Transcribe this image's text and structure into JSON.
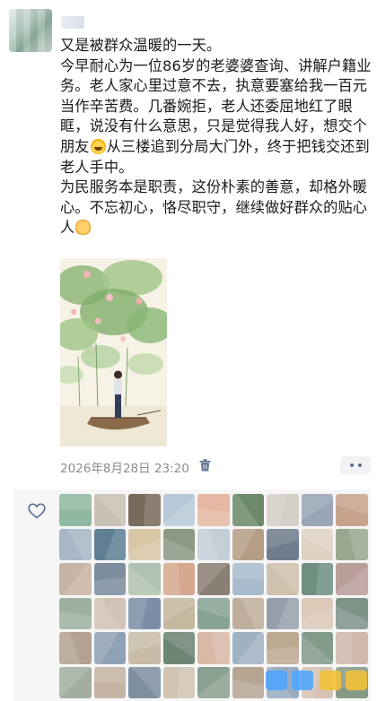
{
  "post": {
    "paragraphs": [
      "又是被群众温暖的一天。",
      "今早耐心为一位86岁的老婆婆查询、讲解户籍业务。老人家心里过意不去，执意要塞给我一百元当作辛苦费。几番婉拒，老人还委屈地红了眼眶，说没有什么意思，只是觉得我人好，想交个朋友",
      "从三楼追到分局大门外，终于把钱交还到老人手中。",
      "为民服务本是职责，这份朴素的善意，却格外暖心。不忘初心，恪尽职守，继续做好群众的贴心人"
    ],
    "timestamp": "2026年8月28日 23:20"
  },
  "icons": {
    "delete": "trash-icon",
    "more": "more-dots-icon",
    "like": "heart-outline-icon",
    "emoji1": "laughing-tears-emoji",
    "emoji2": "raised-fist-emoji"
  },
  "colors": {
    "timestamp": "#8c8c8c",
    "link_blue": "#5a6d8f",
    "likes_bg": "#f6f6f6"
  },
  "likes": {
    "avatars": [
      "#8fb8a0",
      "#c9c2b4",
      "#7a6a5a",
      "#b7c9d8",
      "#e6b7a3",
      "#6c8a6a",
      "#d4d0c8",
      "#9aa6b8",
      "#c7a38c",
      "#a7b7c7",
      "#5f7f95",
      "#d9c6a5",
      "#8c9a84",
      "#c2cfd9",
      "#b59d86",
      "#6e7c8c",
      "#e0d2c3",
      "#97a88f",
      "#c8b4a4",
      "#7d8e9e",
      "#b0c3b0",
      "#d6a88f",
      "#8a7f74",
      "#a9bccd",
      "#cfc1ad",
      "#6f9080",
      "#ba9e9a",
      "#9eb0a2",
      "#d3c2b6",
      "#7b8ea6",
      "#c6b79f",
      "#86a393",
      "#bfae9c",
      "#96a0ad",
      "#dcc9b8",
      "#7f9489",
      "#b3a28f",
      "#8fa2b5",
      "#c9bba6",
      "#6d8574",
      "#d8b9a7",
      "#9fb2c2",
      "#bca991",
      "#829a8a",
      "#cfb9ad",
      "#a2afa0",
      "#c5b3a3",
      "#7e90a0",
      "#d1c4b2",
      "#8aa090",
      "#b7a594",
      "#9aabc0",
      "#d6c3b3",
      "#879a86"
    ]
  }
}
